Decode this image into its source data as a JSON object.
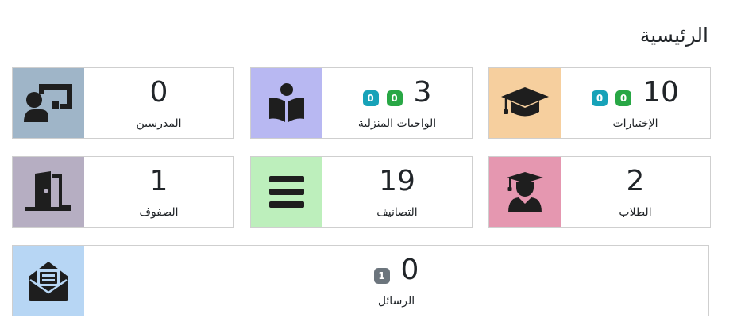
{
  "page": {
    "title": "الرئيسية"
  },
  "cards": {
    "exams": {
      "value": "10",
      "label": "الإختبارات",
      "badges": [
        {
          "value": "0",
          "color": "#17a2b8"
        },
        {
          "value": "0",
          "color": "#28a745"
        }
      ],
      "icon": "graduation-cap-icon",
      "icon_bg": "#f6cf9e"
    },
    "homework": {
      "value": "3",
      "label": "الواجبات المنزلية",
      "badges": [
        {
          "value": "0",
          "color": "#17a2b8"
        },
        {
          "value": "0",
          "color": "#28a745"
        }
      ],
      "icon": "book-reader-icon",
      "icon_bg": "#b8b8f2"
    },
    "teachers": {
      "value": "0",
      "label": "المدرسين",
      "icon": "teacher-board-icon",
      "icon_bg": "#9fb5c8"
    },
    "students": {
      "value": "2",
      "label": "الطلاب",
      "icon": "student-graduate-icon",
      "icon_bg": "#e597b0"
    },
    "categories": {
      "value": "19",
      "label": "التصانيف",
      "icon": "bars-icon",
      "icon_bg": "#bdefbc"
    },
    "classes": {
      "value": "1",
      "label": "الصفوف",
      "icon": "door-open-icon",
      "icon_bg": "#b6aec2"
    },
    "messages": {
      "value": "0",
      "label": "الرسائل",
      "badges": [
        {
          "value": "1",
          "color": "#6c757d"
        }
      ],
      "icon": "envelope-open-text-icon",
      "icon_bg": "#b7d6f4"
    }
  }
}
